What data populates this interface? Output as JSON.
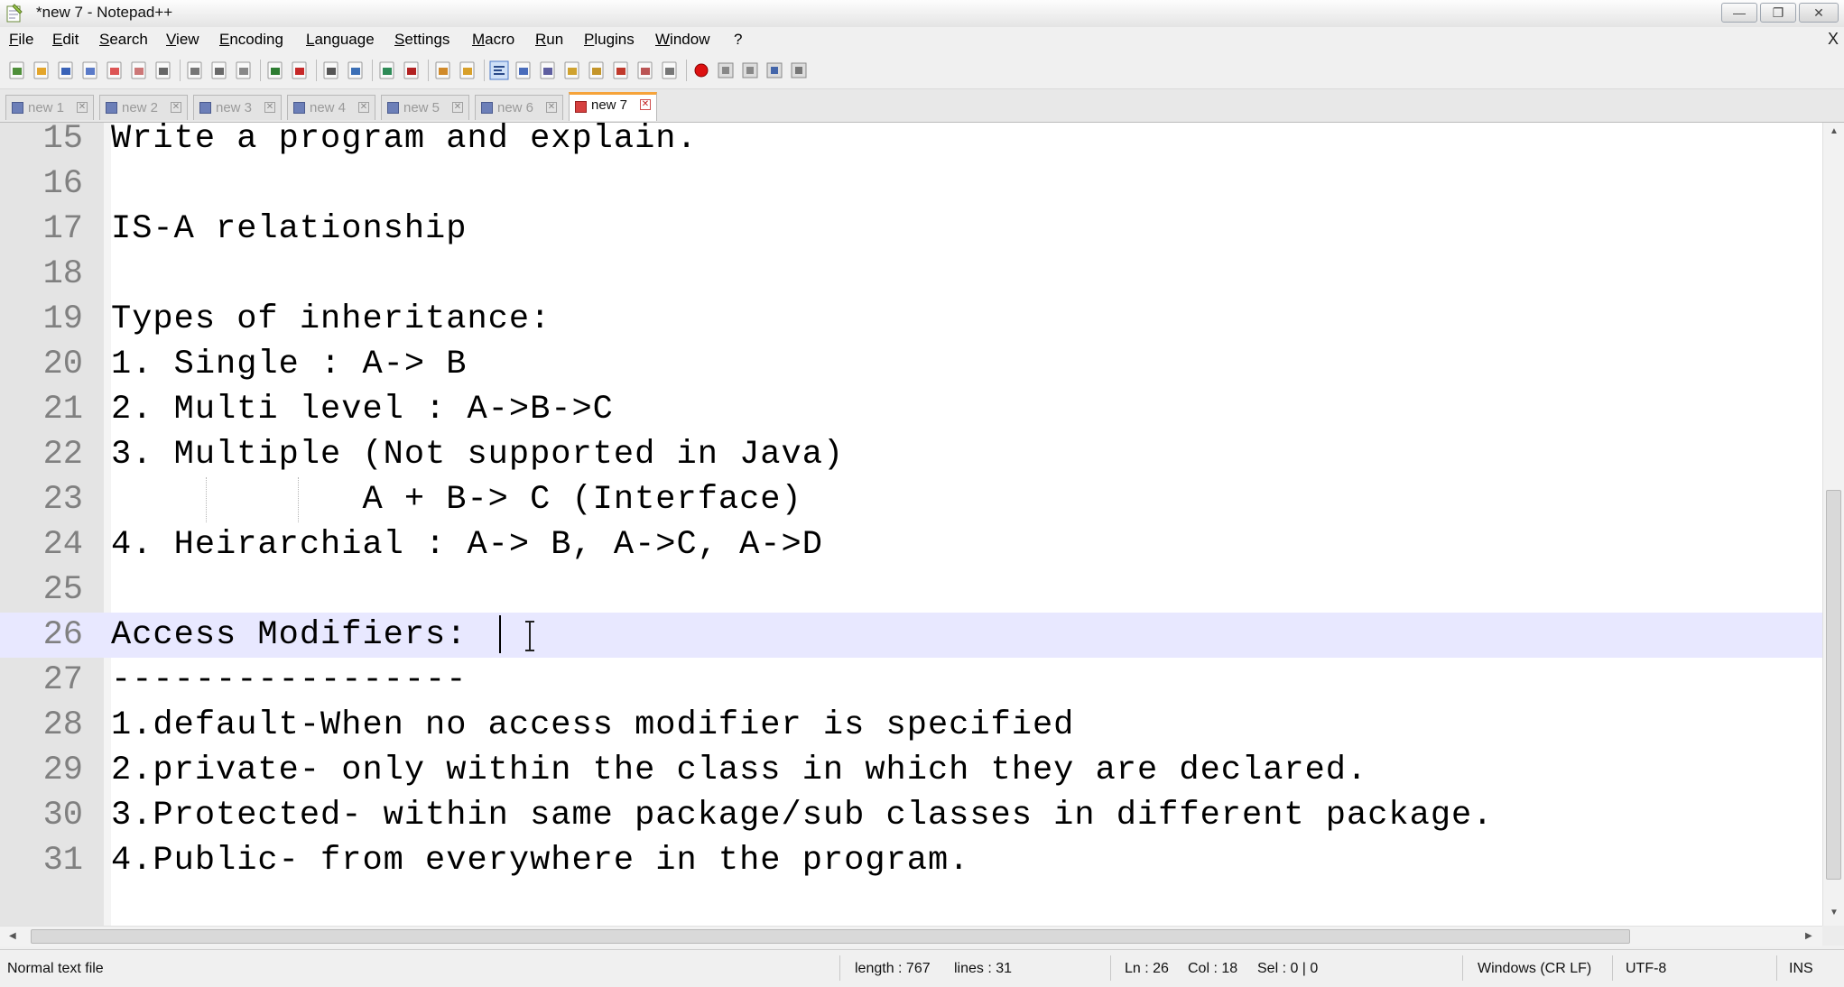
{
  "window": {
    "title": "*new 7 - Notepad++",
    "controls": {
      "minimize": "—",
      "restore": "❐",
      "close": "✕"
    }
  },
  "menu": {
    "items": [
      "File",
      "Edit",
      "Search",
      "View",
      "Encoding",
      "Language",
      "Settings",
      "Macro",
      "Run",
      "Plugins",
      "Window",
      "?"
    ],
    "close_doc": "X"
  },
  "toolbar": {
    "icons": [
      "new-file-icon",
      "open-file-icon",
      "save-icon",
      "save-all-icon",
      "close-icon",
      "close-all-icon",
      "print-icon",
      "cut-icon",
      "copy-icon",
      "paste-icon",
      "undo-icon",
      "redo-icon",
      "find-icon",
      "replace-icon",
      "zoom-in-icon",
      "zoom-out-icon",
      "sync-vertical-icon",
      "sync-horizontal-icon",
      "word-wrap-icon",
      "show-all-chars-icon",
      "indent-guide-icon",
      "udl-icon",
      "doc-map-icon",
      "function-list-icon",
      "folder-workspace-icon",
      "monitoring-icon",
      "record-macro-icon",
      "stop-macro-icon",
      "play-macro-icon",
      "run-macro-multiple-icon",
      "save-macro-icon"
    ]
  },
  "tabs": [
    {
      "label": "new 1",
      "active": false
    },
    {
      "label": "new 2",
      "active": false
    },
    {
      "label": "new 3",
      "active": false
    },
    {
      "label": "new 4",
      "active": false
    },
    {
      "label": "new 5",
      "active": false
    },
    {
      "label": "new 6",
      "active": false
    },
    {
      "label": "new 7",
      "active": true
    }
  ],
  "editor": {
    "current_line": 26,
    "lines": [
      {
        "n": "15",
        "text": "Write a program and explain."
      },
      {
        "n": "16",
        "text": ""
      },
      {
        "n": "17",
        "text": "IS-A relationship"
      },
      {
        "n": "18",
        "text": ""
      },
      {
        "n": "19",
        "text": "Types of inheritance:"
      },
      {
        "n": "20",
        "text": "1. Single : A-> B"
      },
      {
        "n": "21",
        "text": "2. Multi level : A->B->C"
      },
      {
        "n": "22",
        "text": "3. Multiple (Not supported in Java)"
      },
      {
        "n": "23",
        "text": "            A + B-> C (Interface)"
      },
      {
        "n": "24",
        "text": "4. Heirarchial : A-> B, A->C, A->D"
      },
      {
        "n": "25",
        "text": ""
      },
      {
        "n": "26",
        "text": "Access Modifiers:"
      },
      {
        "n": "27",
        "text": "-----------------"
      },
      {
        "n": "28",
        "text": "1.default-When no access modifier is specified"
      },
      {
        "n": "29",
        "text": "2.private- only within the class in which they are declared."
      },
      {
        "n": "30",
        "text": "3.Protected- within same package/sub classes in different package."
      },
      {
        "n": "31",
        "text": "4.Public- from everywhere in the program."
      }
    ]
  },
  "statusbar": {
    "file_type": "Normal text file",
    "length": "length : 767",
    "lines": "lines : 31",
    "ln": "Ln : 26",
    "col": "Col : 18",
    "sel": "Sel : 0 | 0",
    "eol": "Windows (CR LF)",
    "encoding": "UTF-8",
    "mode": "INS"
  },
  "colors": {
    "current_line_bg": "#e8e8ff",
    "gutter_bg": "#e4e4e4",
    "active_tab_accent": "#f6a33a"
  }
}
